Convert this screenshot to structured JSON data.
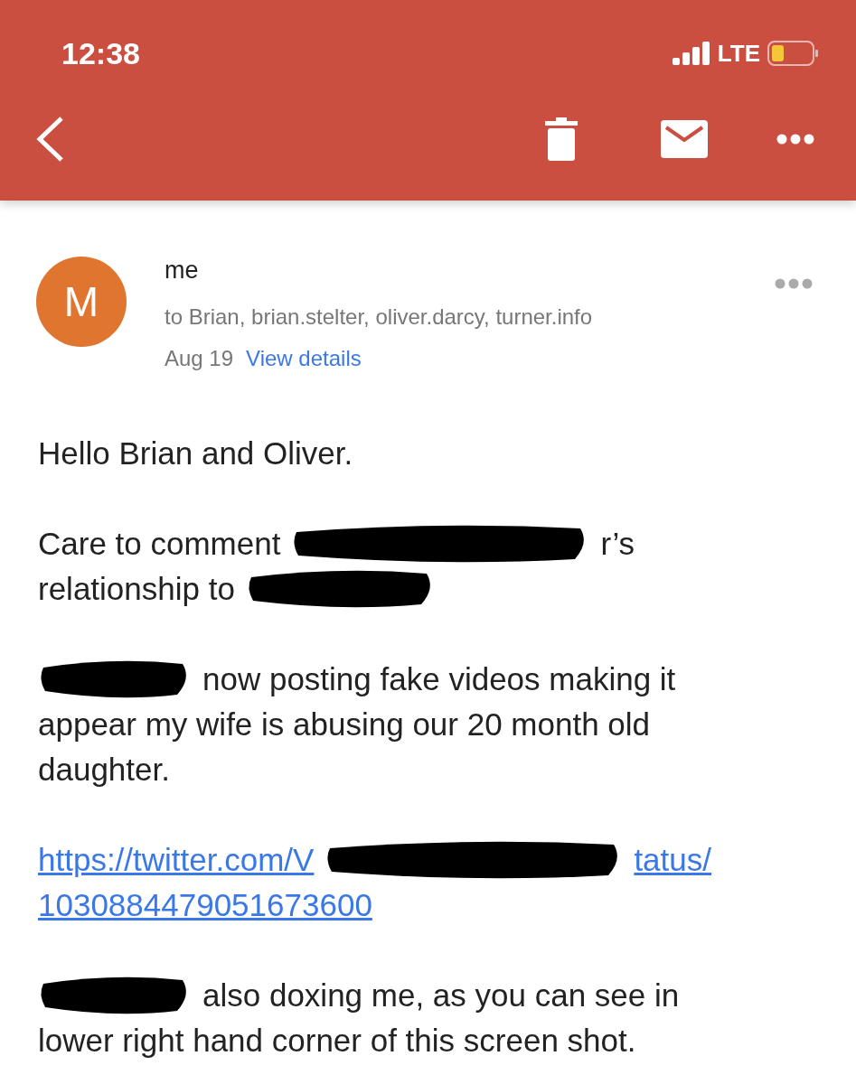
{
  "status_bar": {
    "time": "12:38",
    "network": "LTE",
    "battery_low": true
  },
  "message": {
    "avatar_letter": "M",
    "sender": "me",
    "recipients": "to Brian, brian.stelter, oliver.darcy, turner.info",
    "date": "Aug 19",
    "details_link": "View details"
  },
  "body": [
    {
      "kind": "text",
      "lines": [
        [
          {
            "kind": "text",
            "text": "Hello Brian and Oliver."
          }
        ]
      ]
    },
    {
      "kind": "text",
      "lines": [
        [
          {
            "kind": "text",
            "text": "Care to comment"
          },
          {
            "kind": "redaction"
          },
          {
            "kind": "text",
            "text": "r’s"
          }
        ],
        [
          {
            "kind": "text",
            "text": "relationship to"
          },
          {
            "kind": "redaction"
          }
        ]
      ]
    },
    {
      "kind": "text",
      "lines": [
        [
          {
            "kind": "redaction"
          },
          {
            "kind": "text",
            "text": "now posting fake videos making it"
          }
        ],
        [
          {
            "kind": "text",
            "text": "appear my wife is abusing our 20 month old"
          }
        ],
        [
          {
            "kind": "text",
            "text": "daughter."
          }
        ]
      ]
    },
    {
      "kind": "link",
      "lines": [
        [
          {
            "kind": "text",
            "text": "https://twitter.com/V"
          },
          {
            "kind": "redaction"
          },
          {
            "kind": "text",
            "text": "tatus/"
          }
        ],
        [
          {
            "kind": "text",
            "text": "1030884479051673600"
          }
        ]
      ]
    },
    {
      "kind": "text",
      "lines": [
        [
          {
            "kind": "redaction"
          },
          {
            "kind": "text",
            "text": "also doxing me, as you can see in"
          }
        ],
        [
          {
            "kind": "text",
            "text": "lower right hand corner of this screen shot."
          }
        ]
      ]
    }
  ]
}
